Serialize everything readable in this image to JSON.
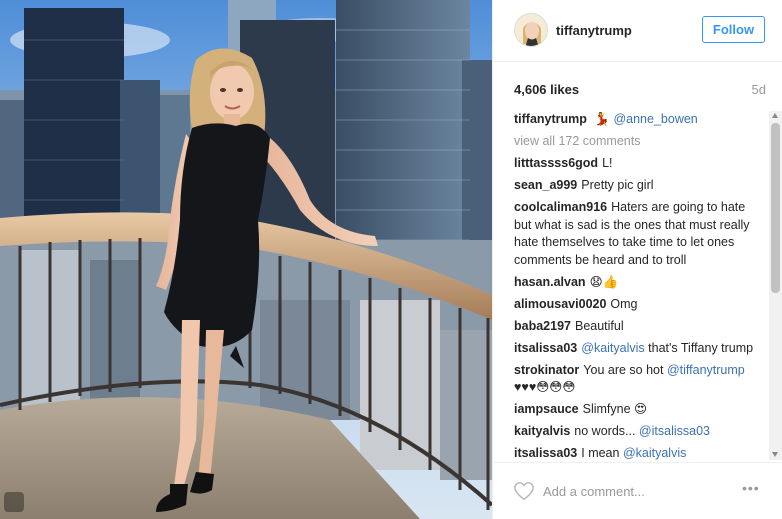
{
  "post": {
    "username": "tiffanytrump",
    "follow_label": "Follow",
    "likes": "4,606 likes",
    "age": "5d",
    "caption": {
      "user": "tiffanytrump",
      "emoji": "💃",
      "mention": "@anne_bowen"
    },
    "view_all": "view all 172 comments",
    "comments": [
      {
        "user": "litttassss6god",
        "text": "L!"
      },
      {
        "user": "sean_a999",
        "text": "Pretty pic girl"
      },
      {
        "user": "coolcaliman916",
        "text": "Haters are going to hate but what is sad is the ones that must really hate themselves to take time to let ones comments be heard and to troll"
      },
      {
        "user": "hasan.alvan",
        "text": "😧👍"
      },
      {
        "user": "alimousavi0020",
        "text": "Omg"
      },
      {
        "user": "baba2197",
        "text": "Beautiful"
      },
      {
        "user": "itsalissa03",
        "mention": "@kaityalvis",
        "text": "that's Tiffany trump"
      },
      {
        "user": "strokinator",
        "text": "You are so hot",
        "mention": "@tiffanytrump",
        "text2": "♥♥♥😳😳😳"
      },
      {
        "user": "iampsauce",
        "text": "Slimfyne 😍"
      },
      {
        "user": "kaityalvis",
        "text": "no words...",
        "mention": "@itsalissa03"
      },
      {
        "user": "itsalissa03",
        "text": "I mean",
        "mention": "@kaityalvis"
      }
    ],
    "add_comment_placeholder": "Add a comment...",
    "more_label": "•••"
  },
  "icons": {
    "avatar": "avatar-icon",
    "heart": "heart-icon",
    "more": "more-options-icon"
  },
  "colors": {
    "accent": "#3897f0",
    "mention": "#3a72b4",
    "muted": "#999999"
  }
}
